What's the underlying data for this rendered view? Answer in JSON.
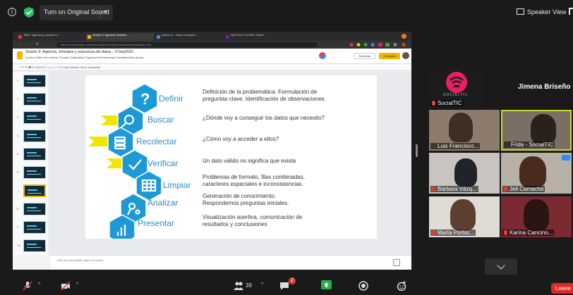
{
  "topbar": {
    "sound_button_label": "Turn on Original Sound",
    "speaker_view_label": "Speaker View"
  },
  "browser": {
    "tabs": [
      {
        "label": "Taller \"Agencias y acceso a ...",
        "active": false
      },
      {
        "label": "Sesión 3: Agencia, formato ...",
        "active": true
      },
      {
        "label": "Datos en - Visión completa ...",
        "active": false
      },
      {
        "label": "Neil Form CCSHR, Online ...",
        "active": false
      }
    ],
    "url": "https://docs.google.com/presentation/d/1abg9c4w0sAbcd/edit#slide=id.p"
  },
  "slides_app": {
    "doc_title": "Sesión 3: Agencia, formatos y estructura de datos - 27sep2021",
    "menu_items": "Archivo  Editar  Ver  Insertar  Formato  Diapositiva  Organizar  Herramientas  Complementos  Ayuda",
    "toolbar_text": "+  ↶  ↷  🖶  ⚲  100%  ▾   ↖  ▭  ◯  ⟋  ✎   Fondo   Diseño   Tema   Transición",
    "present_label": "Presentar",
    "share_label": "Compartir",
    "notes_placeholder": "Haz clic para añadir notas del orador"
  },
  "slide": {
    "steps": [
      {
        "label": "Definir",
        "desc": [
          "Definición de la problemática. Formulación de",
          "preguntas clave. Identificación de observaciones."
        ],
        "icon": "question-icon"
      },
      {
        "label": "Buscar",
        "desc": [
          "¿Dónde voy a conseguir los datos que necesito?"
        ],
        "icon": "magnifier-icon"
      },
      {
        "label": "Recolectar",
        "desc": [
          "¿Cómo voy a acceder a ellos?"
        ],
        "icon": "database-icon"
      },
      {
        "label": "Verificar",
        "desc": [
          "Un dato válido no significa que exista"
        ],
        "icon": "check-icon"
      },
      {
        "label": "Limpiar",
        "desc": [
          "Problemas de formato, filas combinadas,",
          "caracteres especiales e inconsistencias."
        ],
        "icon": "table-icon"
      },
      {
        "label": "Analizar",
        "desc": [
          "Generación de conocimiento.",
          "Respondemos preguntas iniciales."
        ],
        "icon": "network-icon"
      },
      {
        "label": "Presentar",
        "desc": [
          "Visualización asertiva, comunicación de",
          "resultados y conclusiones"
        ],
        "icon": "bar-chart-icon"
      }
    ]
  },
  "participants": {
    "featured_name": "Jimena Briseño",
    "tiles": [
      {
        "name": "SocialTIC"
      },
      {
        "name": "Luis Francisco..."
      },
      {
        "name": "Frida - SocialTIC"
      },
      {
        "name": "Bárbara Vázq..."
      },
      {
        "name": "Jeli Camacho"
      },
      {
        "name": "Marta Portoc..."
      },
      {
        "name": "Karina Cancino..."
      }
    ],
    "logo_text": "SOCIALTIC"
  },
  "bottombar": {
    "participant_count": "39",
    "chat_badge": "2",
    "leave_label": "Leave"
  },
  "colors": {
    "accent_blue": "#2a8ec4",
    "hex_cyan": "#1d9ad6",
    "arrow_yellow": "#f2e600",
    "leave_red": "#e02828",
    "active_speaker": "#c8d92b"
  }
}
